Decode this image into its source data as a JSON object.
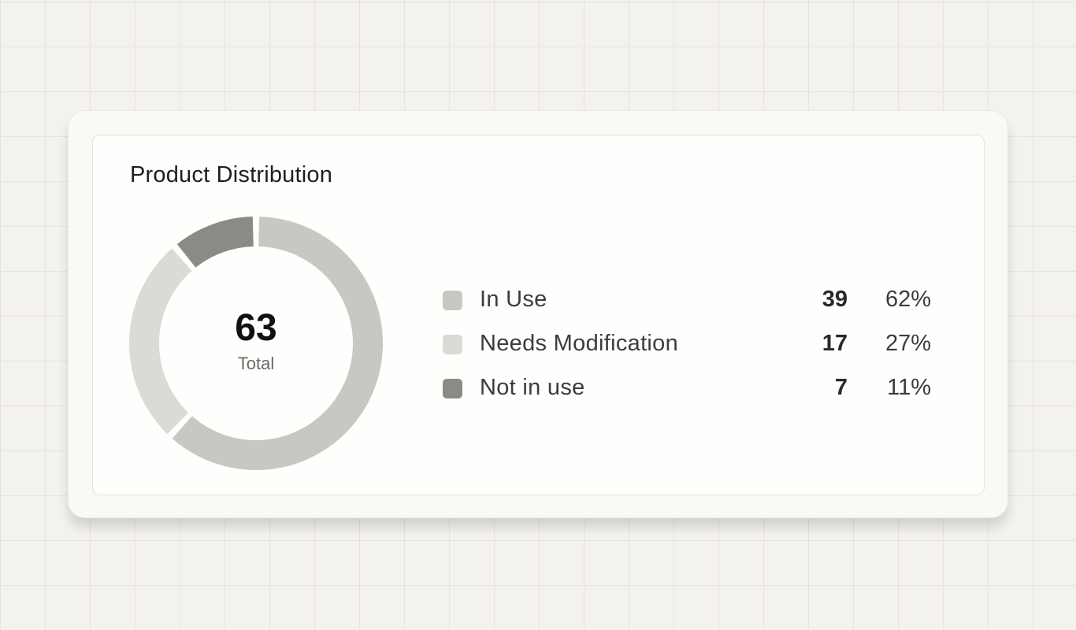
{
  "card": {
    "title": "Product Distribution"
  },
  "chart_data": {
    "type": "pie",
    "title": "Product Distribution",
    "total_value": "63",
    "total_label": "Total",
    "categories": [
      "In Use",
      "Needs Modification",
      "Not in use"
    ],
    "values": [
      39,
      17,
      7
    ],
    "percent_labels": [
      "62%",
      "27%",
      "11%"
    ],
    "colors": [
      "#c9c7c1",
      "#dcdad5",
      "#8b8a84"
    ],
    "legend_position": "right"
  }
}
